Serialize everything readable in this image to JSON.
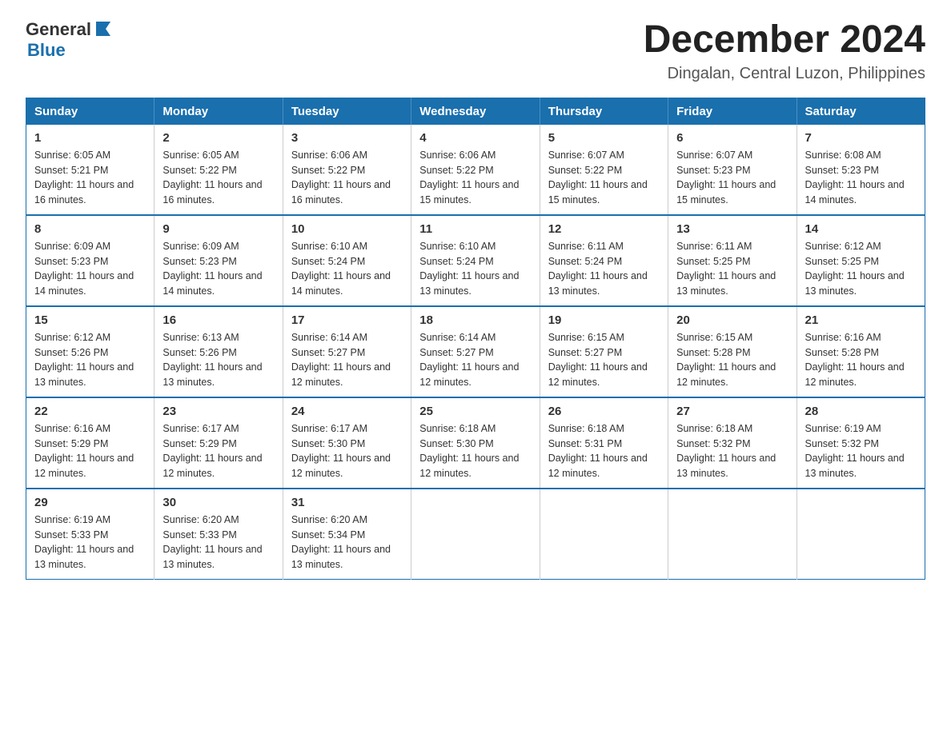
{
  "header": {
    "logo": {
      "general": "General",
      "blue": "Blue",
      "aria": "GeneralBlue logo"
    },
    "title": "December 2024",
    "subtitle": "Dingalan, Central Luzon, Philippines"
  },
  "weekdays": [
    "Sunday",
    "Monday",
    "Tuesday",
    "Wednesday",
    "Thursday",
    "Friday",
    "Saturday"
  ],
  "weeks": [
    [
      {
        "day": "1",
        "sunrise": "Sunrise: 6:05 AM",
        "sunset": "Sunset: 5:21 PM",
        "daylight": "Daylight: 11 hours and 16 minutes."
      },
      {
        "day": "2",
        "sunrise": "Sunrise: 6:05 AM",
        "sunset": "Sunset: 5:22 PM",
        "daylight": "Daylight: 11 hours and 16 minutes."
      },
      {
        "day": "3",
        "sunrise": "Sunrise: 6:06 AM",
        "sunset": "Sunset: 5:22 PM",
        "daylight": "Daylight: 11 hours and 16 minutes."
      },
      {
        "day": "4",
        "sunrise": "Sunrise: 6:06 AM",
        "sunset": "Sunset: 5:22 PM",
        "daylight": "Daylight: 11 hours and 15 minutes."
      },
      {
        "day": "5",
        "sunrise": "Sunrise: 6:07 AM",
        "sunset": "Sunset: 5:22 PM",
        "daylight": "Daylight: 11 hours and 15 minutes."
      },
      {
        "day": "6",
        "sunrise": "Sunrise: 6:07 AM",
        "sunset": "Sunset: 5:23 PM",
        "daylight": "Daylight: 11 hours and 15 minutes."
      },
      {
        "day": "7",
        "sunrise": "Sunrise: 6:08 AM",
        "sunset": "Sunset: 5:23 PM",
        "daylight": "Daylight: 11 hours and 14 minutes."
      }
    ],
    [
      {
        "day": "8",
        "sunrise": "Sunrise: 6:09 AM",
        "sunset": "Sunset: 5:23 PM",
        "daylight": "Daylight: 11 hours and 14 minutes."
      },
      {
        "day": "9",
        "sunrise": "Sunrise: 6:09 AM",
        "sunset": "Sunset: 5:23 PM",
        "daylight": "Daylight: 11 hours and 14 minutes."
      },
      {
        "day": "10",
        "sunrise": "Sunrise: 6:10 AM",
        "sunset": "Sunset: 5:24 PM",
        "daylight": "Daylight: 11 hours and 14 minutes."
      },
      {
        "day": "11",
        "sunrise": "Sunrise: 6:10 AM",
        "sunset": "Sunset: 5:24 PM",
        "daylight": "Daylight: 11 hours and 13 minutes."
      },
      {
        "day": "12",
        "sunrise": "Sunrise: 6:11 AM",
        "sunset": "Sunset: 5:24 PM",
        "daylight": "Daylight: 11 hours and 13 minutes."
      },
      {
        "day": "13",
        "sunrise": "Sunrise: 6:11 AM",
        "sunset": "Sunset: 5:25 PM",
        "daylight": "Daylight: 11 hours and 13 minutes."
      },
      {
        "day": "14",
        "sunrise": "Sunrise: 6:12 AM",
        "sunset": "Sunset: 5:25 PM",
        "daylight": "Daylight: 11 hours and 13 minutes."
      }
    ],
    [
      {
        "day": "15",
        "sunrise": "Sunrise: 6:12 AM",
        "sunset": "Sunset: 5:26 PM",
        "daylight": "Daylight: 11 hours and 13 minutes."
      },
      {
        "day": "16",
        "sunrise": "Sunrise: 6:13 AM",
        "sunset": "Sunset: 5:26 PM",
        "daylight": "Daylight: 11 hours and 13 minutes."
      },
      {
        "day": "17",
        "sunrise": "Sunrise: 6:14 AM",
        "sunset": "Sunset: 5:27 PM",
        "daylight": "Daylight: 11 hours and 12 minutes."
      },
      {
        "day": "18",
        "sunrise": "Sunrise: 6:14 AM",
        "sunset": "Sunset: 5:27 PM",
        "daylight": "Daylight: 11 hours and 12 minutes."
      },
      {
        "day": "19",
        "sunrise": "Sunrise: 6:15 AM",
        "sunset": "Sunset: 5:27 PM",
        "daylight": "Daylight: 11 hours and 12 minutes."
      },
      {
        "day": "20",
        "sunrise": "Sunrise: 6:15 AM",
        "sunset": "Sunset: 5:28 PM",
        "daylight": "Daylight: 11 hours and 12 minutes."
      },
      {
        "day": "21",
        "sunrise": "Sunrise: 6:16 AM",
        "sunset": "Sunset: 5:28 PM",
        "daylight": "Daylight: 11 hours and 12 minutes."
      }
    ],
    [
      {
        "day": "22",
        "sunrise": "Sunrise: 6:16 AM",
        "sunset": "Sunset: 5:29 PM",
        "daylight": "Daylight: 11 hours and 12 minutes."
      },
      {
        "day": "23",
        "sunrise": "Sunrise: 6:17 AM",
        "sunset": "Sunset: 5:29 PM",
        "daylight": "Daylight: 11 hours and 12 minutes."
      },
      {
        "day": "24",
        "sunrise": "Sunrise: 6:17 AM",
        "sunset": "Sunset: 5:30 PM",
        "daylight": "Daylight: 11 hours and 12 minutes."
      },
      {
        "day": "25",
        "sunrise": "Sunrise: 6:18 AM",
        "sunset": "Sunset: 5:30 PM",
        "daylight": "Daylight: 11 hours and 12 minutes."
      },
      {
        "day": "26",
        "sunrise": "Sunrise: 6:18 AM",
        "sunset": "Sunset: 5:31 PM",
        "daylight": "Daylight: 11 hours and 12 minutes."
      },
      {
        "day": "27",
        "sunrise": "Sunrise: 6:18 AM",
        "sunset": "Sunset: 5:32 PM",
        "daylight": "Daylight: 11 hours and 13 minutes."
      },
      {
        "day": "28",
        "sunrise": "Sunrise: 6:19 AM",
        "sunset": "Sunset: 5:32 PM",
        "daylight": "Daylight: 11 hours and 13 minutes."
      }
    ],
    [
      {
        "day": "29",
        "sunrise": "Sunrise: 6:19 AM",
        "sunset": "Sunset: 5:33 PM",
        "daylight": "Daylight: 11 hours and 13 minutes."
      },
      {
        "day": "30",
        "sunrise": "Sunrise: 6:20 AM",
        "sunset": "Sunset: 5:33 PM",
        "daylight": "Daylight: 11 hours and 13 minutes."
      },
      {
        "day": "31",
        "sunrise": "Sunrise: 6:20 AM",
        "sunset": "Sunset: 5:34 PM",
        "daylight": "Daylight: 11 hours and 13 minutes."
      },
      null,
      null,
      null,
      null
    ]
  ]
}
